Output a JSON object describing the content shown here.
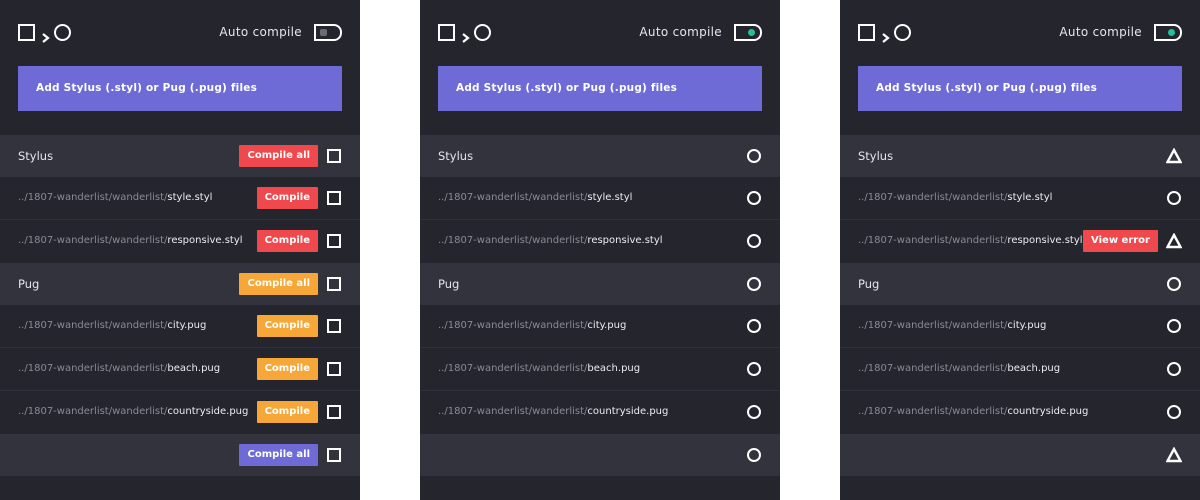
{
  "colors": {
    "panel_bg": "#25252e",
    "group_row_bg": "#33333d",
    "accent_purple": "#6e6bd6",
    "compile_red": "#f0494d",
    "compile_orange": "#f7a738",
    "toggle_on_green": "#21c29b"
  },
  "panels": [
    {
      "header": {
        "logo_icons": [
          "square-icon",
          "chevron-right-icon",
          "circle-icon"
        ],
        "auto_compile_label": "Auto compile",
        "auto_compile_on": false
      },
      "add_button_label": "Add Stylus (.styl) or Pug (.pug) files",
      "rows": [
        {
          "kind": "group",
          "label": "Stylus",
          "button": "Compile all",
          "button_color": "red",
          "status": "square"
        },
        {
          "kind": "file",
          "dir": "../1807-wanderlist/wanderlist/",
          "file": "style.styl",
          "button": "Compile",
          "button_color": "red",
          "status": "square"
        },
        {
          "kind": "file",
          "dir": "../1807-wanderlist/wanderlist/",
          "file": "responsive.styl",
          "button": "Compile",
          "button_color": "red",
          "status": "square"
        },
        {
          "kind": "group",
          "label": "Pug",
          "button": "Compile all",
          "button_color": "orange",
          "status": "square"
        },
        {
          "kind": "file",
          "dir": "../1807-wanderlist/wanderlist/",
          "file": "city.pug",
          "button": "Compile",
          "button_color": "orange",
          "status": "square"
        },
        {
          "kind": "file",
          "dir": "../1807-wanderlist/wanderlist/",
          "file": "beach.pug",
          "button": "Compile",
          "button_color": "orange",
          "status": "square"
        },
        {
          "kind": "file",
          "dir": "../1807-wanderlist/wanderlist/",
          "file": "countryside.pug",
          "button": "Compile",
          "button_color": "orange",
          "status": "square"
        },
        {
          "kind": "group",
          "label": "",
          "button": "Compile all",
          "button_color": "purple",
          "status": "square"
        }
      ]
    },
    {
      "header": {
        "logo_icons": [
          "square-icon",
          "chevron-right-icon",
          "circle-icon"
        ],
        "auto_compile_label": "Auto compile",
        "auto_compile_on": true
      },
      "add_button_label": "Add Stylus (.styl) or Pug (.pug) files",
      "rows": [
        {
          "kind": "group",
          "label": "Stylus",
          "button": "",
          "status": "circle"
        },
        {
          "kind": "file",
          "dir": "../1807-wanderlist/wanderlist/",
          "file": "style.styl",
          "button": "",
          "status": "circle"
        },
        {
          "kind": "file",
          "dir": "../1807-wanderlist/wanderlist/",
          "file": "responsive.styl",
          "button": "",
          "status": "circle"
        },
        {
          "kind": "group",
          "label": "Pug",
          "button": "",
          "status": "circle"
        },
        {
          "kind": "file",
          "dir": "../1807-wanderlist/wanderlist/",
          "file": "city.pug",
          "button": "",
          "status": "circle"
        },
        {
          "kind": "file",
          "dir": "../1807-wanderlist/wanderlist/",
          "file": "beach.pug",
          "button": "",
          "status": "circle"
        },
        {
          "kind": "file",
          "dir": "../1807-wanderlist/wanderlist/",
          "file": "countryside.pug",
          "button": "",
          "status": "circle"
        },
        {
          "kind": "group",
          "label": "",
          "button": "",
          "status": "circle"
        }
      ]
    },
    {
      "header": {
        "logo_icons": [
          "square-icon",
          "chevron-right-icon",
          "circle-icon"
        ],
        "auto_compile_label": "Auto compile",
        "auto_compile_on": true
      },
      "add_button_label": "Add Stylus (.styl) or Pug (.pug) files",
      "rows": [
        {
          "kind": "group",
          "label": "Stylus",
          "button": "",
          "status": "triangle"
        },
        {
          "kind": "file",
          "dir": "../1807-wanderlist/wanderlist/",
          "file": "style.styl",
          "button": "",
          "status": "circle"
        },
        {
          "kind": "file",
          "dir": "../1807-wanderlist/wanderlist/",
          "file": "responsive.styl",
          "button": "View error",
          "button_color": "red",
          "status": "triangle"
        },
        {
          "kind": "group",
          "label": "Pug",
          "button": "",
          "status": "circle"
        },
        {
          "kind": "file",
          "dir": "../1807-wanderlist/wanderlist/",
          "file": "city.pug",
          "button": "",
          "status": "circle"
        },
        {
          "kind": "file",
          "dir": "../1807-wanderlist/wanderlist/",
          "file": "beach.pug",
          "button": "",
          "status": "circle"
        },
        {
          "kind": "file",
          "dir": "../1807-wanderlist/wanderlist/",
          "file": "countryside.pug",
          "button": "",
          "status": "circle"
        },
        {
          "kind": "group",
          "label": "",
          "button": "",
          "status": "triangle"
        }
      ]
    }
  ]
}
